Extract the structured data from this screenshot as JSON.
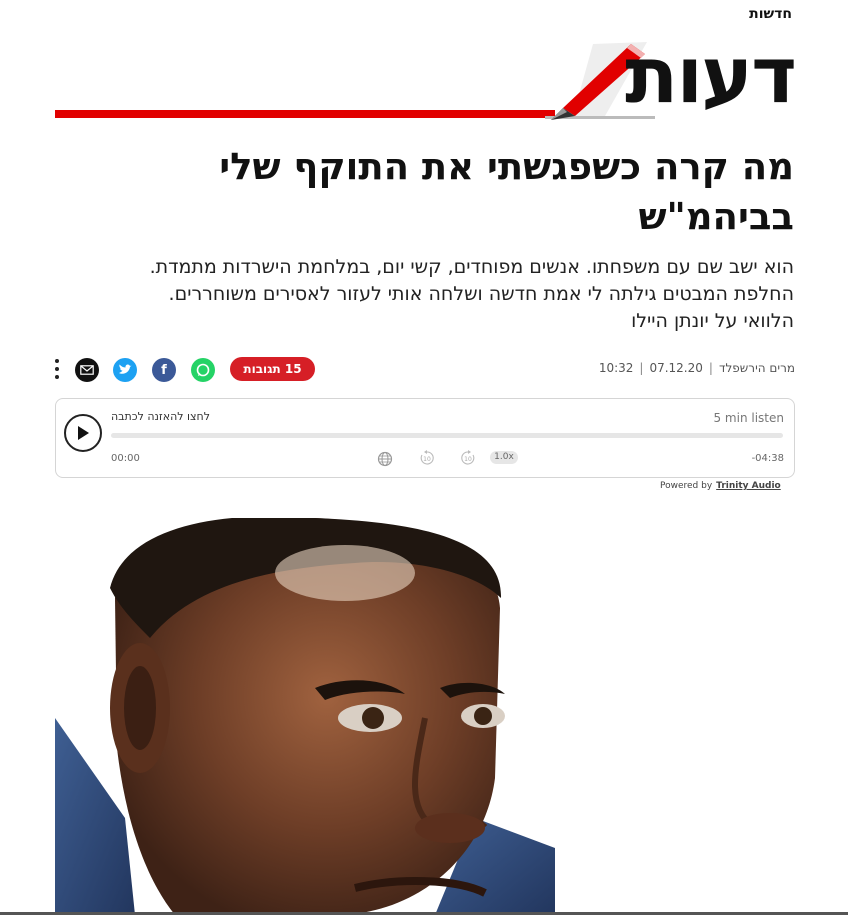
{
  "breadcrumb": "חדשות",
  "section": {
    "title": "דעות"
  },
  "article": {
    "headline_line1": "מה קרה כשפגשתי את התוקף שלי",
    "headline_line2": "בביהמ\"ש",
    "subheadline_line1": "הוא ישב שם עם משפחתו. אנשים מפוחדים, קשי יום, במלחמת הישרדות מתמדת.",
    "subheadline_line2": "החלפת המבטים גילתה לי אמת חדשה ושלחה אותי לעזור לאסירים משוחררים.",
    "subheadline_line3": "הלוואי על יונתן היילו",
    "author": "מרים הירשפלד",
    "date": "07.12.20",
    "time": "10:32",
    "comments_label": "15 תגובות"
  },
  "share": {
    "icons": [
      "whatsapp-icon",
      "facebook-icon",
      "twitter-icon",
      "email-icon",
      "more-icon"
    ]
  },
  "audio_player": {
    "prompt": "לחצו להאזנה לכתבה",
    "duration_label": "5 min listen",
    "time_start": "00:00",
    "time_end": "-04:38",
    "speed": "1.0x",
    "skip_back": "10",
    "skip_forward": "10",
    "powered_by": "Powered by",
    "brand": "Trinity Audio",
    "progress_fraction": 0
  },
  "colors": {
    "accent_red": "#e10000",
    "comments_red": "#d61f26",
    "whatsapp": "#25d366",
    "facebook": "#3b5998",
    "twitter": "#1da1f2"
  }
}
